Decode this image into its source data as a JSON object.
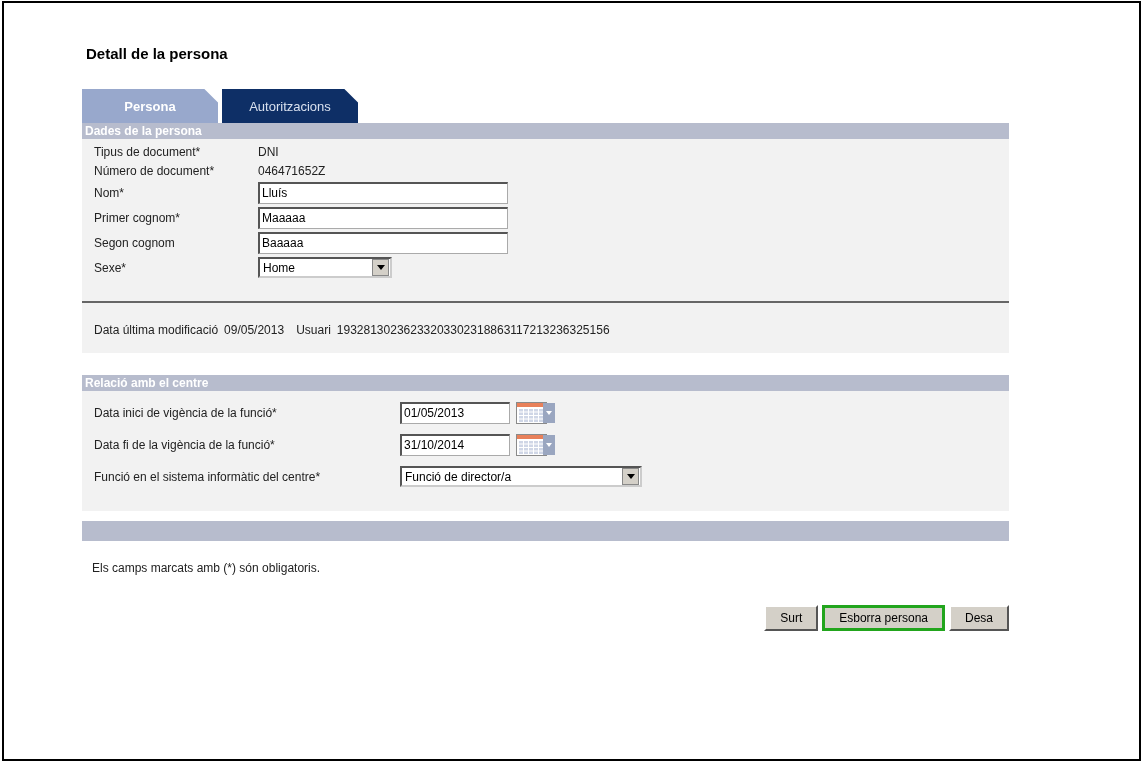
{
  "title": "Detall de la persona",
  "tabs": [
    {
      "label": "Persona",
      "selected": true
    },
    {
      "label": "Autoritzacions",
      "selected": false
    }
  ],
  "person_section": {
    "title": "Dades de la persona",
    "fields": [
      {
        "kind": "text",
        "label": "Tipus de document*",
        "value": "DNI"
      },
      {
        "kind": "text",
        "label": "Número de document*",
        "value": "046471652Z"
      },
      {
        "kind": "input",
        "label": "Nom*",
        "value": "Lluís"
      },
      {
        "kind": "input",
        "label": "Primer cognom*",
        "value": "Maaaaa"
      },
      {
        "kind": "input",
        "label": "Segon cognom",
        "value": "Baaaaa"
      },
      {
        "kind": "select",
        "label": "Sexe*",
        "value": "Home"
      }
    ],
    "modification": {
      "label": "Data última modificació",
      "date": "09/05/2013",
      "user_label": "Usuari",
      "user": "19328130236233203302318863117213236325156"
    }
  },
  "centre_section": {
    "title": "Relació amb el centre",
    "fields": [
      {
        "kind": "date",
        "label": "Data inici de vigència de la funció*",
        "value": "01/05/2013"
      },
      {
        "kind": "date",
        "label": "Data fi de la vigència de la funció*",
        "value": "31/10/2014"
      },
      {
        "kind": "select",
        "label": "Funció en el sistema informàtic del centre*",
        "value": "Funció de director/a"
      }
    ]
  },
  "note": "Els camps marcats amb (*) són obligatoris.",
  "buttons": [
    {
      "label": "Surt",
      "focused": false
    },
    {
      "label": "Esborra persona",
      "focused": true
    },
    {
      "label": "Desa",
      "focused": false
    }
  ]
}
